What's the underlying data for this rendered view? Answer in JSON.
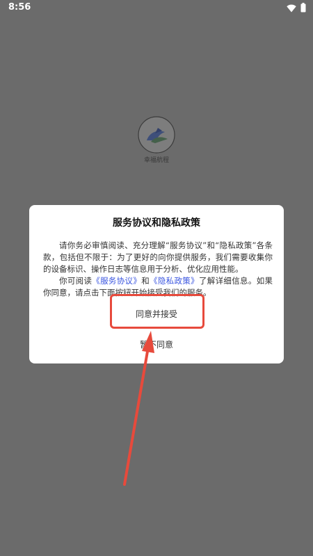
{
  "status_bar": {
    "time": "8:56",
    "icons": [
      "wifi-icon",
      "battery-icon"
    ]
  },
  "background_app": {
    "logo_icon": "app-logo-icon",
    "name": "幸福航程"
  },
  "dialog": {
    "title": "服务协议和隐私政策",
    "paragraph1": "请你务必审慎阅读、充分理解“服务协议”和“隐私政策”各条款，包括但不限于：为了更好的向你提供服务，我们需要收集你的设备标识、操作日志等信息用于分析、优化应用性能。",
    "paragraph2_prefix": "你可阅读",
    "link_service": "《服务协议》",
    "paragraph2_and": "和",
    "link_privacy": "《隐私政策》",
    "paragraph2_suffix": "了解详细信息。如果你同意，请点击下面按钮开始接受我们的服务。",
    "agree_label": "同意并接受",
    "decline_label": "暂不同意"
  },
  "colors": {
    "scrim": "#6b6b6b",
    "dialog_bg": "#ffffff",
    "link": "#3a55e0",
    "annotation": "#e74a3c"
  }
}
